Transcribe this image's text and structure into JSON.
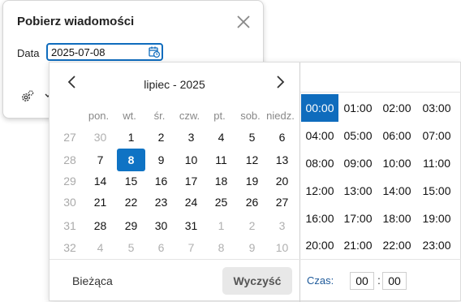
{
  "dialog": {
    "title": "Pobierz wiadomości",
    "date_label": "Data",
    "date_value": "2025-07-08"
  },
  "calendar": {
    "month_title": "lipiec - 2025",
    "weekdays": [
      "pon.",
      "wt.",
      "śr.",
      "czw.",
      "pt.",
      "sob.",
      "niedz."
    ],
    "weeks": [
      {
        "num": "27",
        "days": [
          {
            "d": "30",
            "m": true
          },
          {
            "d": "1"
          },
          {
            "d": "2"
          },
          {
            "d": "3"
          },
          {
            "d": "4"
          },
          {
            "d": "5"
          },
          {
            "d": "6"
          }
        ]
      },
      {
        "num": "28",
        "days": [
          {
            "d": "7"
          },
          {
            "d": "8",
            "s": true
          },
          {
            "d": "9"
          },
          {
            "d": "10"
          },
          {
            "d": "11"
          },
          {
            "d": "12"
          },
          {
            "d": "13"
          }
        ]
      },
      {
        "num": "29",
        "days": [
          {
            "d": "14"
          },
          {
            "d": "15"
          },
          {
            "d": "16"
          },
          {
            "d": "17"
          },
          {
            "d": "18"
          },
          {
            "d": "19"
          },
          {
            "d": "20"
          }
        ]
      },
      {
        "num": "30",
        "days": [
          {
            "d": "21"
          },
          {
            "d": "22"
          },
          {
            "d": "23"
          },
          {
            "d": "24"
          },
          {
            "d": "25"
          },
          {
            "d": "26"
          },
          {
            "d": "27"
          }
        ]
      },
      {
        "num": "31",
        "days": [
          {
            "d": "28"
          },
          {
            "d": "29"
          },
          {
            "d": "30"
          },
          {
            "d": "31"
          },
          {
            "d": "1",
            "m": true
          },
          {
            "d": "2",
            "m": true
          },
          {
            "d": "3",
            "m": true
          }
        ]
      },
      {
        "num": "32",
        "days": [
          {
            "d": "4",
            "m": true
          },
          {
            "d": "5",
            "m": true
          },
          {
            "d": "6",
            "m": true
          },
          {
            "d": "7",
            "m": true
          },
          {
            "d": "8",
            "m": true
          },
          {
            "d": "9",
            "m": true
          },
          {
            "d": "10",
            "m": true
          }
        ]
      }
    ],
    "today_label": "Bieżąca",
    "clear_label": "Wyczyść"
  },
  "time": {
    "hours": [
      "00:00",
      "01:00",
      "02:00",
      "03:00",
      "04:00",
      "05:00",
      "06:00",
      "07:00",
      "08:00",
      "09:00",
      "10:00",
      "11:00",
      "12:00",
      "13:00",
      "14:00",
      "15:00",
      "16:00",
      "17:00",
      "18:00",
      "19:00",
      "20:00",
      "21:00",
      "22:00",
      "23:00"
    ],
    "selected_hour": "00:00",
    "label": "Czas:",
    "hour_value": "00",
    "separator": ":",
    "minute_value": "00"
  },
  "colors": {
    "accent": "#0f6cbd",
    "selected_day": "#0f73c4"
  }
}
